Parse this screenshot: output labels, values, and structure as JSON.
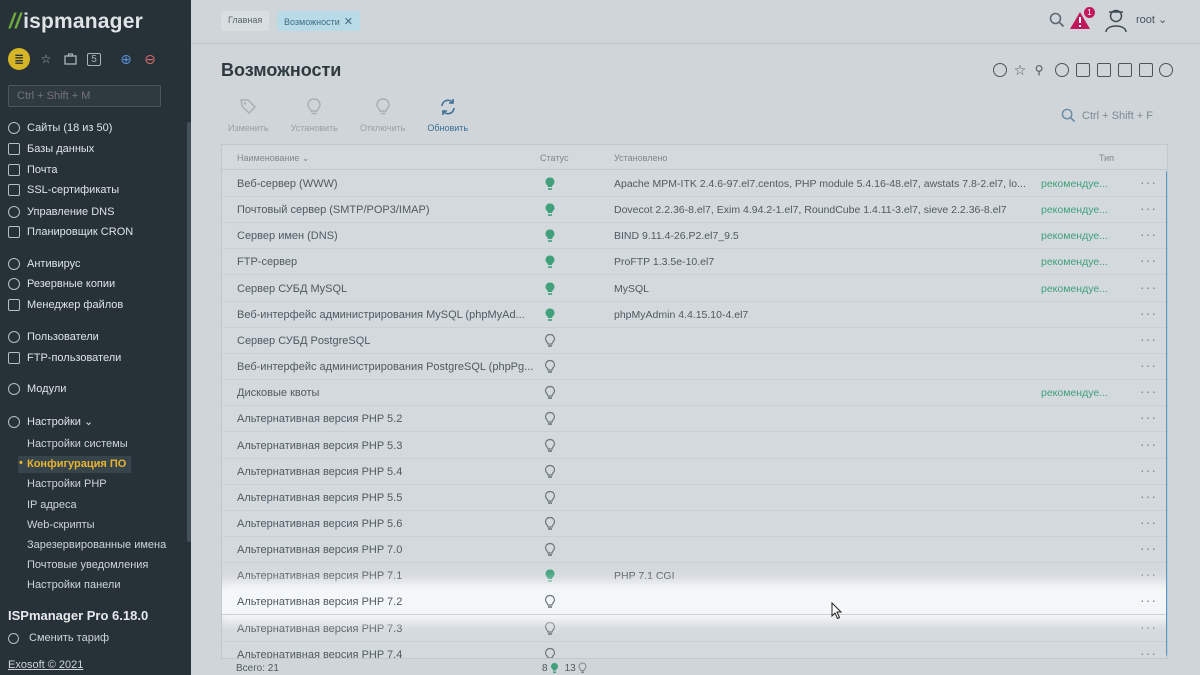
{
  "app": {
    "logo_mark": "//",
    "logo_text": "ispmanager"
  },
  "sidebar": {
    "quick_favorites_label": "≣",
    "quick_number": "5",
    "search_placeholder": "Ctrl + Shift + M",
    "items": [
      {
        "label": "Сайты (18 из 50)",
        "icon": "globe-icon"
      },
      {
        "label": "Базы данных",
        "icon": "database-icon"
      },
      {
        "label": "Почта",
        "icon": "mail-icon"
      },
      {
        "label": "SSL-сертификаты",
        "icon": "certificate-icon"
      },
      {
        "label": "Управление DNS",
        "icon": "dns-icon"
      },
      {
        "label": "Планировщик CRON",
        "icon": "calendar-icon"
      },
      {
        "label": "Антивирус",
        "icon": "antivirus-icon"
      },
      {
        "label": "Резервные копии",
        "icon": "backup-icon"
      },
      {
        "label": "Менеджер файлов",
        "icon": "folder-icon"
      },
      {
        "label": "Пользователи",
        "icon": "user-icon"
      },
      {
        "label": "FTP-пользователи",
        "icon": "ftp-icon"
      },
      {
        "label": "Модули",
        "icon": "modules-icon"
      },
      {
        "label": "Настройки ⌄",
        "icon": "gear-icon"
      }
    ],
    "sub_items": [
      "Настройки системы",
      "Конфигурация ПО",
      "Настройки PHP",
      "IP адреса",
      "Web-скрипты",
      "Зарезервированные имена",
      "Почтовые уведомления",
      "Настройки панели"
    ],
    "version": "ISPmanager Pro 6.18.0",
    "tariff": "Сменить тариф",
    "copyright": "Exosoft © 2021"
  },
  "topbar": {
    "crumb_home": "Главная",
    "crumb_current": "Возможности",
    "close_mark": "✕",
    "notifications": "1",
    "user": "root ⌄"
  },
  "page": {
    "title": "Возможности",
    "actions": [
      {
        "label": "Изменить",
        "enabled": false
      },
      {
        "label": "Установить",
        "enabled": false
      },
      {
        "label": "Отключить",
        "enabled": false
      },
      {
        "label": "Обновить",
        "enabled": true
      }
    ],
    "grid_search_placeholder": "Ctrl + Shift + F",
    "columns": {
      "name": "Наименование ⌄",
      "status": "Статус",
      "installed": "Установлено",
      "type": "Тип"
    },
    "rows": [
      {
        "name": "Веб-сервер (WWW)",
        "status": "on",
        "installed": "Apache MPM-ITK 2.4.6-97.el7.centos, PHP module 5.4.16-48.el7, awstats 7.8-2.el7, lo...",
        "type": "рекомендуе..."
      },
      {
        "name": "Почтовый сервер (SMTP/POP3/IMAP)",
        "status": "on",
        "installed": "Dovecot 2.2.36-8.el7, Exim 4.94.2-1.el7, RoundCube 1.4.11-3.el7, sieve 2.2.36-8.el7",
        "type": "рекомендуе..."
      },
      {
        "name": "Сервер имен (DNS)",
        "status": "on",
        "installed": "BIND 9.11.4-26.P2.el7_9.5",
        "type": "рекомендуе..."
      },
      {
        "name": "FTP-сервер",
        "status": "on",
        "installed": "ProFTP 1.3.5e-10.el7",
        "type": "рекомендуе..."
      },
      {
        "name": "Сервер СУБД MySQL",
        "status": "on",
        "installed": "MySQL",
        "type": "рекомендуе..."
      },
      {
        "name": "Веб-интерфейс администрирования MySQL (phpMyAd...",
        "status": "on",
        "installed": "phpMyAdmin 4.4.15.10-4.el7",
        "type": ""
      },
      {
        "name": "Сервер СУБД PostgreSQL",
        "status": "off",
        "installed": "",
        "type": ""
      },
      {
        "name": "Веб-интерфейс администрирования PostgreSQL (phpPg...",
        "status": "off",
        "installed": "",
        "type": ""
      },
      {
        "name": "Дисковые квоты",
        "status": "off",
        "installed": "",
        "type": "рекомендуе..."
      },
      {
        "name": "Альтернативная версия PHP 5.2",
        "status": "off",
        "installed": "",
        "type": ""
      },
      {
        "name": "Альтернативная версия PHP 5.3",
        "status": "off",
        "installed": "",
        "type": ""
      },
      {
        "name": "Альтернативная версия PHP 5.4",
        "status": "off",
        "installed": "",
        "type": ""
      },
      {
        "name": "Альтернативная версия PHP 5.5",
        "status": "off",
        "installed": "",
        "type": ""
      },
      {
        "name": "Альтернативная версия PHP 5.6",
        "status": "off",
        "installed": "",
        "type": ""
      },
      {
        "name": "Альтернативная версия PHP 7.0",
        "status": "off",
        "installed": "",
        "type": ""
      },
      {
        "name": "Альтернативная версия PHP 7.1",
        "status": "on",
        "installed": "PHP 7.1 CGI",
        "type": ""
      },
      {
        "name": "Альтернативная версия PHP 7.2",
        "status": "off",
        "installed": "",
        "type": "",
        "highlighted": true
      },
      {
        "name": "Альтернативная версия PHP 7.3",
        "status": "off",
        "installed": "",
        "type": ""
      },
      {
        "name": "Альтернативная версия PHP 7.4",
        "status": "off",
        "installed": "",
        "type": ""
      }
    ],
    "row_menu": "···",
    "footer": {
      "total": "Всего: 21",
      "on_count": "8",
      "off_count": "13"
    }
  },
  "colors": {
    "sidebar_bg": "#273238",
    "accent": "#e6b431",
    "status_on": "#3fa07a",
    "link": "#3a6f96",
    "badge": "#c2185b"
  }
}
